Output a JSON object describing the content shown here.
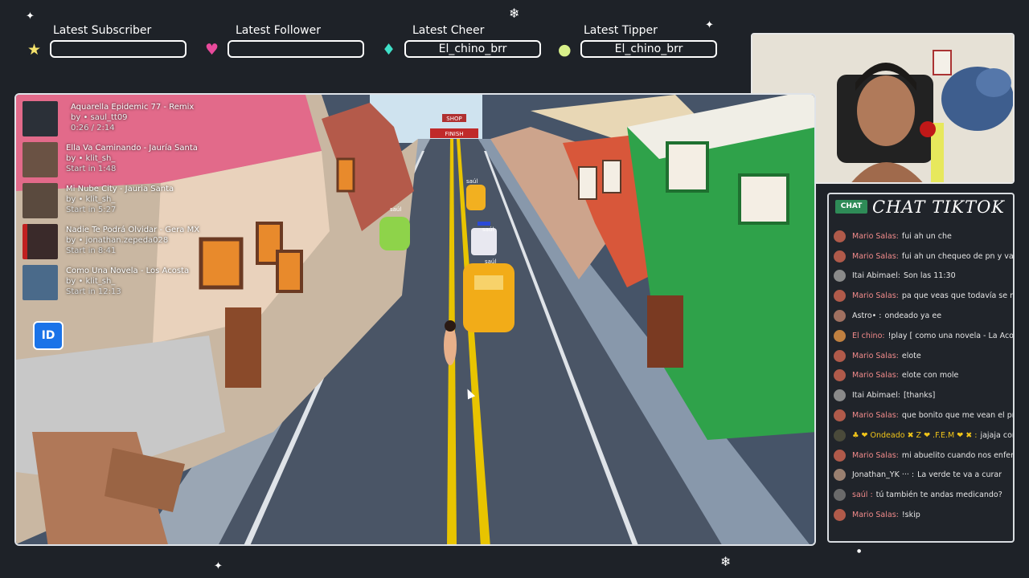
{
  "alerts": [
    {
      "title": "Latest Subscriber",
      "value": "",
      "icon": "star-icon",
      "color": "#f5e36b"
    },
    {
      "title": "Latest Follower",
      "value": "",
      "icon": "heart-icon",
      "color": "#e84a9b"
    },
    {
      "title": "Latest Cheer",
      "value": "El_chino_brr",
      "icon": "gem-icon",
      "color": "#3fe0c8"
    },
    {
      "title": "Latest Tipper",
      "value": "El_chino_brr",
      "icon": "coin-icon",
      "color": "#d8f08a"
    }
  ],
  "game": {
    "finish_sign": "FINISH",
    "shop_sign": "SHOP",
    "vehicle_tags": [
      "saúl",
      "saúl",
      "saúl",
      "saúl"
    ]
  },
  "playlist": {
    "current": {
      "title": "Aquarella Epidemic 77 - Remix",
      "by": "by • saul_tt09",
      "time": "0:26 / 2:14"
    },
    "queue": [
      {
        "title": "Ella Va Caminando - Jauría Santa",
        "by": "by • klit_sh_",
        "start": "Start in 1:48"
      },
      {
        "title": "Mi Nube City - Jauria Santa",
        "by": "by • klit_sh_",
        "start": "Start in 5:27"
      },
      {
        "title": "Nadie Te Podrá Olvidar - Gera MX",
        "by": "by • jonathan.zepeda028",
        "start": "Start in 8:41"
      },
      {
        "title": "Como Una Novela - Los Acosta",
        "by": "by • klit_sh_",
        "start": "Start in 12:13"
      }
    ]
  },
  "id_button": "ID",
  "chat": {
    "badge": "CHAT",
    "title": "CHAT TIKTOK",
    "messages": [
      {
        "user": "Mario Salas:",
        "text": "fui ah un che",
        "color": "#f28b8b"
      },
      {
        "user": "Mario Salas:",
        "text": "fui ah un chequeo de pn y valió b",
        "color": "#f28b8b"
      },
      {
        "user": "Itai Abimael:",
        "text": "Son las 11:30",
        "color": "#e6e6e6"
      },
      {
        "user": "Mario Salas:",
        "text": "pa que veas que todavía se me p",
        "color": "#f28b8b"
      },
      {
        "user": "Astro• :",
        "text": "ondeado ya ee",
        "color": "#e6e6e6"
      },
      {
        "user": "El chino:",
        "text": "!play [ como una novela - La Acosta",
        "color": "#f28b8b"
      },
      {
        "user": "Mario Salas:",
        "text": "elote",
        "color": "#f28b8b"
      },
      {
        "user": "Mario Salas:",
        "text": "elote con mole",
        "color": "#f28b8b"
      },
      {
        "user": "Itai Abimael:",
        "text": "[thanks]",
        "color": "#e6e6e6"
      },
      {
        "user": "Mario Salas:",
        "text": "que bonito que me vean el pncit",
        "color": "#f28b8b"
      },
      {
        "user": "♣ ❤ Ondeado ✖ Z ❤ .F.E.M ❤ ✖ :",
        "text": "jajaja com",
        "color": "#f0c419"
      },
      {
        "user": "Mario Salas:",
        "text": "mi abuelito cuando nos enferma",
        "color": "#f28b8b"
      },
      {
        "user": "Jonathan_YK ··· :",
        "text": "La verde te va a curar",
        "color": "#e6e6e6"
      },
      {
        "user": "saúl :",
        "text": "tú también te andas medicando?",
        "color": "#f28b8b"
      },
      {
        "user": "Mario Salas:",
        "text": "!skip",
        "color": "#f28b8b"
      }
    ]
  },
  "colors": {
    "background": "#1e2228",
    "road": "#4a5566",
    "frame_border": "#dfe3e8",
    "id_button": "#1a73e8",
    "chat_badge": "#2e8b57"
  }
}
